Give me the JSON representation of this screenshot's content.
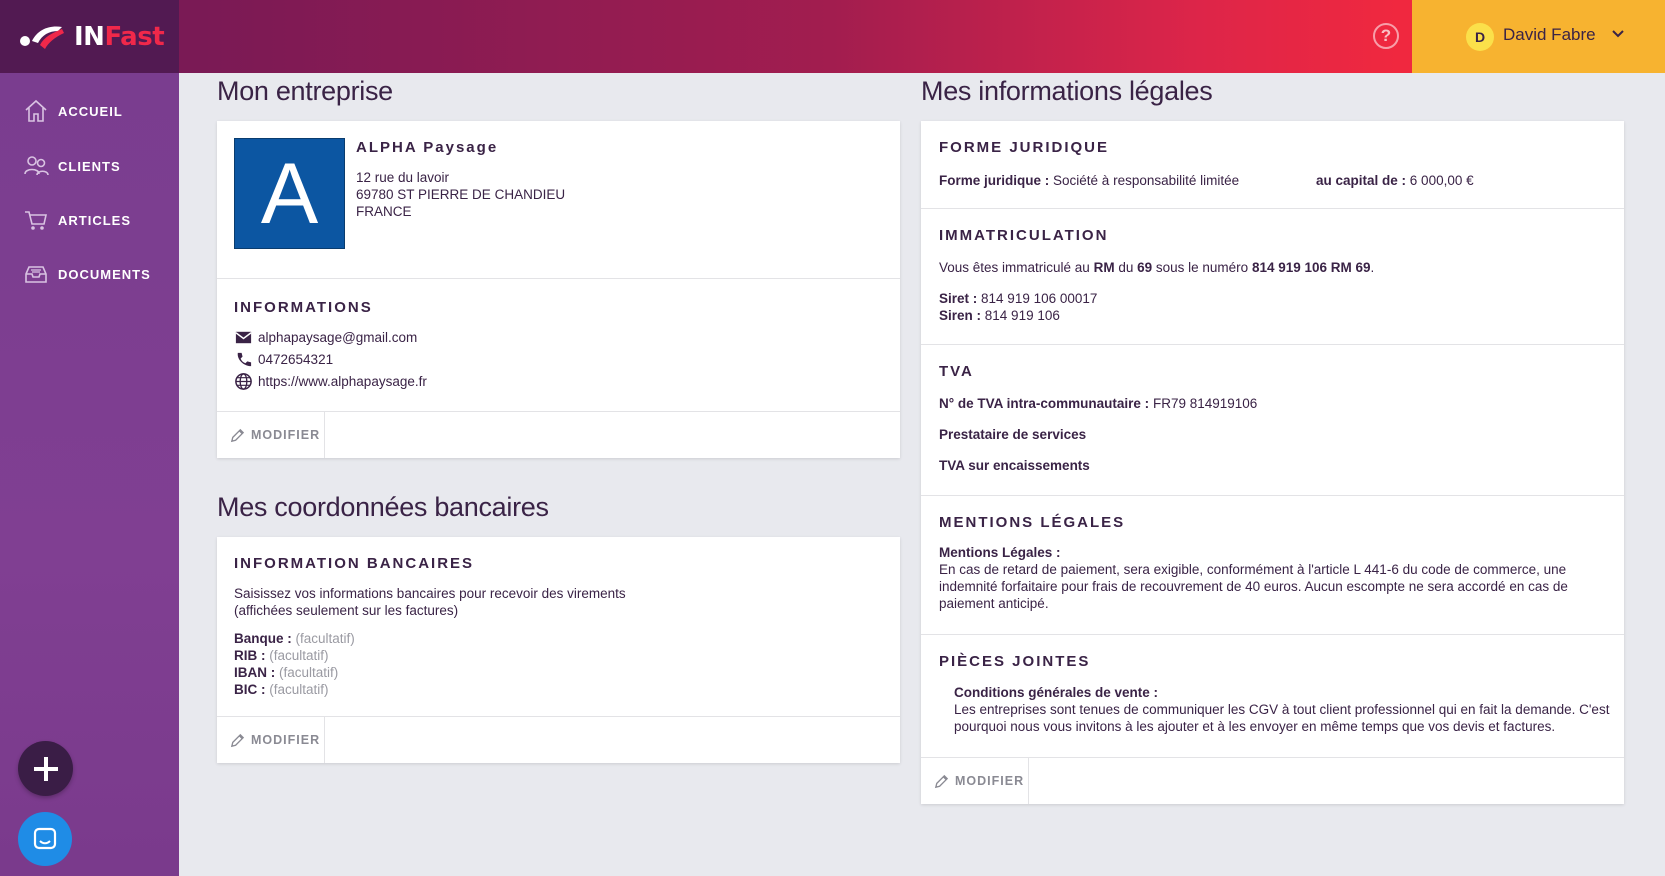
{
  "header": {
    "brand_in": "IN",
    "brand_fast": "Fast",
    "help_icon": "question-icon",
    "user": {
      "initial": "D",
      "name": "David Fabre"
    }
  },
  "sidebar": {
    "items": [
      {
        "label": "ACCUEIL",
        "icon": "home-icon"
      },
      {
        "label": "CLIENTS",
        "icon": "users-icon"
      },
      {
        "label": "ARTICLES",
        "icon": "cart-icon"
      },
      {
        "label": "DOCUMENTS",
        "icon": "inbox-icon"
      }
    ]
  },
  "entreprise": {
    "title": "Mon entreprise",
    "logo_letter": "A",
    "name": "ALPHA Paysage",
    "address": [
      "12 rue du lavoir",
      "69780 ST PIERRE DE CHANDIEU",
      "FRANCE"
    ],
    "informations_title": "INFORMATIONS",
    "email": "alphapaysage@gmail.com",
    "phone": "0472654321",
    "website": "https://www.alphapaysage.fr",
    "modify_label": "MODIFIER"
  },
  "bancaire": {
    "title": "Mes coordonnées bancaires",
    "section_title": "INFORMATION BANCAIRES",
    "desc_line1": "Saisissez vos informations bancaires pour recevoir des virements",
    "desc_line2": "(affichées seulement sur les factures)",
    "fields": [
      {
        "label": "Banque :",
        "value": "(facultatif)"
      },
      {
        "label": "RIB :",
        "value": "(facultatif)"
      },
      {
        "label": "IBAN :",
        "value": "(facultatif)"
      },
      {
        "label": "BIC :",
        "value": "(facultatif)"
      }
    ],
    "modify_label": "MODIFIER"
  },
  "legales": {
    "title": "Mes informations légales",
    "forme": {
      "heading": "FORME JURIDIQUE",
      "label": "Forme juridique :",
      "value": "Société à responsabilité limitée",
      "capital_label": "au capital de :",
      "capital_value": "6 000,00 €"
    },
    "immat": {
      "heading": "IMMATRICULATION",
      "t1": "Vous êtes immatriculé au ",
      "rm": "RM",
      "t2": " du ",
      "dep": "69",
      "t3": " sous le numéro ",
      "numero": "814 919 106 RM 69",
      "t4": ".",
      "siret_label": "Siret :",
      "siret": "814 919 106 00017",
      "siren_label": "Siren :",
      "siren": "814 919 106"
    },
    "tva": {
      "heading": "TVA",
      "num_label": "N° de TVA intra-communautaire :",
      "num_value": "FR79 814919106",
      "line2": "Prestataire de services",
      "line3": "TVA sur encaissements"
    },
    "mentions": {
      "heading": "MENTIONS LÉGALES",
      "label": "Mentions Légales :",
      "line1": "En cas de retard de paiement, sera exigible, conformément à l'article L 441-6 du code de commerce, une",
      "line2": "indemnité forfaitaire pour frais de recouvrement de 40 euros. Aucun escompte ne sera accordé en cas de",
      "line3": "paiement anticipé."
    },
    "pieces": {
      "heading": "PIÈCES JOINTES",
      "label": "Conditions générales de vente :",
      "line1": "Les entreprises sont tenues de communiquer les CGV à tout client professionnel qui en fait la demande. C'est",
      "line2": "pourquoi nous vous invitons à les ajouter et à les envoyer en même temps que vos devis et factures."
    },
    "modify_label": "MODIFIER"
  },
  "colors": {
    "sidebar": "#7a3d8f",
    "logo_bg": "#521a52",
    "user_bg": "#f7b330",
    "accent_red": "#f0283f",
    "text_dark": "#3a2346"
  }
}
